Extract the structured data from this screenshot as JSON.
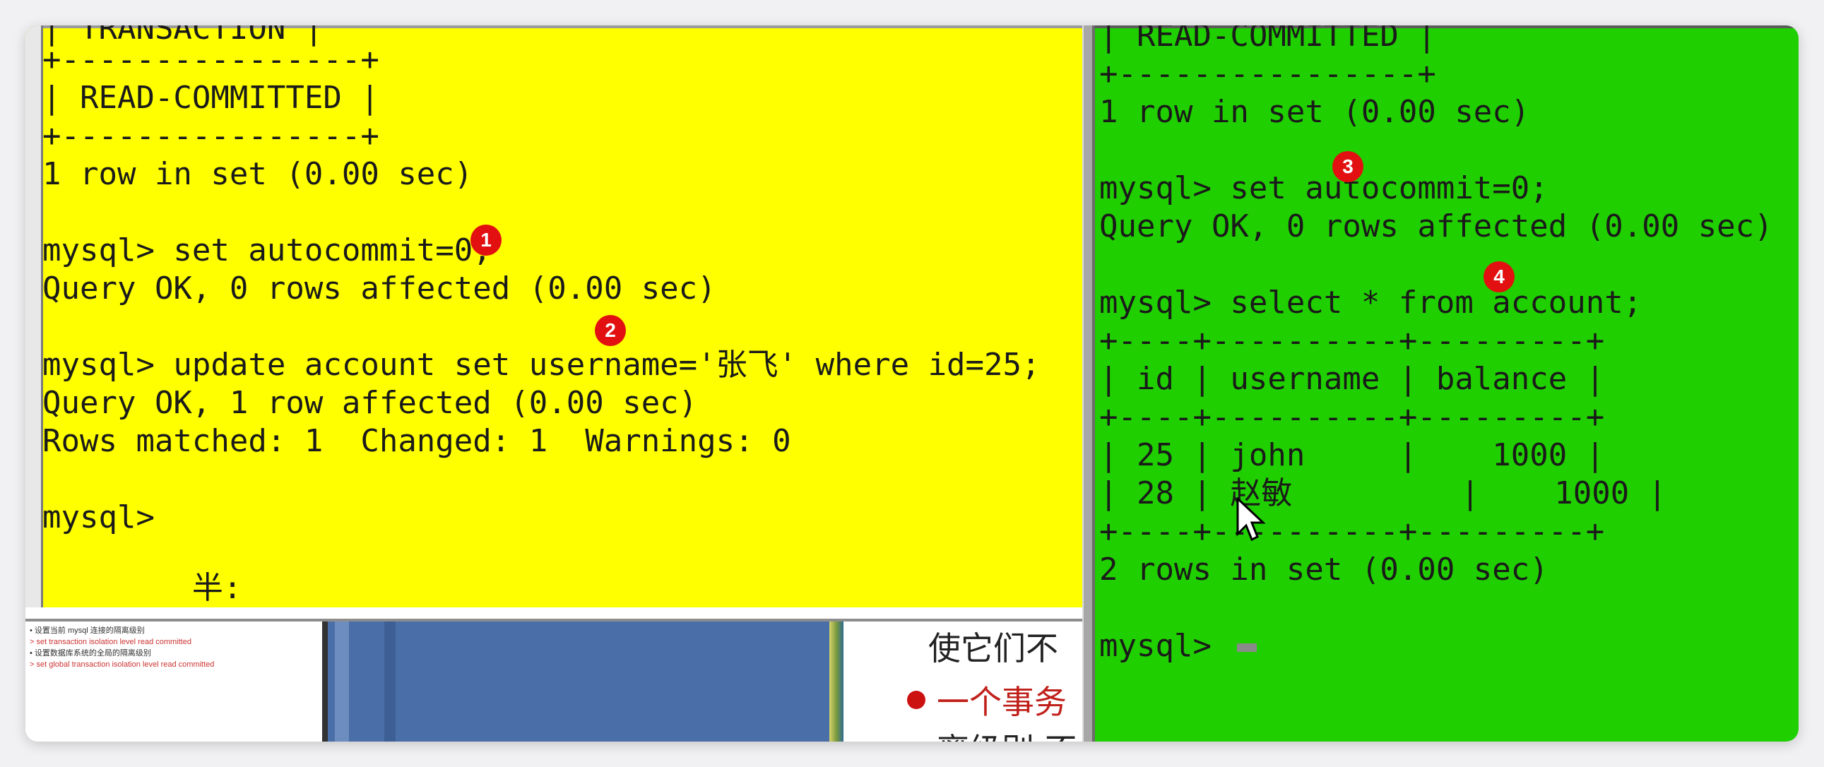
{
  "left_terminal": {
    "lines": [
      "+----------------+",
      "| READ-COMMITTED |",
      "+----------------+",
      "1 row in set (0.00 sec)",
      "",
      "mysql> set autocommit=0;",
      "Query OK, 0 rows affected (0.00 sec)",
      "",
      "mysql> update account set username='张飞' where id=25;",
      "Query OK, 1 row affected (0.00 sec)",
      "Rows matched: 1  Changed: 1  Warnings: 0",
      "",
      "mysql>",
      "",
      "        半:"
    ],
    "background": "#ffff00"
  },
  "right_terminal": {
    "lines": [
      "| READ-COMMITTED |",
      "+----------------+",
      "1 row in set (0.00 sec)",
      "",
      "mysql> set autocommit=0;",
      "Query OK, 0 rows affected (0.00 sec)",
      "",
      "mysql> select * from account;",
      "+----+----------+---------+",
      "| id | username | balance |",
      "+----+----------+---------+",
      "| 25 | john     |    1000 |",
      "| 28 | 赵敏         |    1000 |",
      "+----+----------+---------+",
      "2 rows in set (0.00 sec)",
      "",
      "mysql> "
    ],
    "background": "#20cf00"
  },
  "badges": [
    "1",
    "2",
    "3",
    "4"
  ],
  "bottom_strip": {
    "thumb_lines": [
      "• 设置当前 mysql 连接的隔离级别",
      "   > set transaction isolation level read committed",
      "• 设置数据库系统的全局的隔离级别",
      "   > set global transaction isolation level read committed"
    ],
    "slide_text_1": "使它们不",
    "slide_text_2": "一个事务",
    "slide_text_3": "离级别 不"
  },
  "colors": {
    "badge": "#e21010",
    "left_bg": "#ffff00",
    "right_bg": "#20cf00"
  }
}
